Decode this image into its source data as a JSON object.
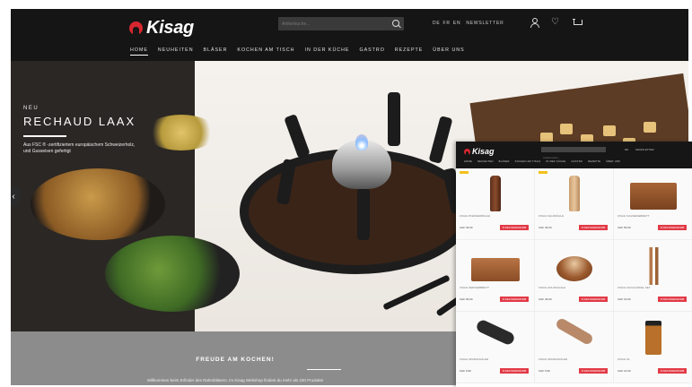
{
  "header": {
    "brand": "Kisag",
    "search_placeholder": "Artikelsuche...",
    "langs": [
      "DE",
      "FR",
      "EN"
    ],
    "newsletter": "NEWSLETTER",
    "icons": [
      "user-icon",
      "heart-icon",
      "cart-icon"
    ]
  },
  "nav": [
    {
      "label": "HOME",
      "active": true
    },
    {
      "label": "NEUHEITEN"
    },
    {
      "label": "BLÄSER"
    },
    {
      "label": "KOCHEN AM TISCH"
    },
    {
      "label": "IN DER KÜCHE"
    },
    {
      "label": "GASTRO"
    },
    {
      "label": "REZEPTE"
    },
    {
      "label": "ÜBER UNS"
    }
  ],
  "hero": {
    "kicker": "NEU",
    "title": "RECHAUD LAAX",
    "description": "Aus FSC ® -zertifiziertem europäischem Schweizerholz, und Gusseisen gefertigt",
    "prev_arrow": "‹"
  },
  "band": {
    "title": "FREUDE AM KOCHEN!",
    "description": "Willkommen beim Erfinder des Rahmbläsers. Im Kisag Webshop findest du mehr als 230 Produkte"
  },
  "shop": {
    "brand": "Kisag",
    "search_placeholder": "Artikelsuche...",
    "nav": [
      "HOME",
      "NEUHEITEN",
      "BLÄSER",
      "KOCHEN AM TISCH",
      "IN DER KÜCHE",
      "GASTRO",
      "REZEPTE",
      "ÜBER UNS"
    ],
    "products": [
      {
        "name": "KISAG PFEFFERMÜHLE",
        "price": "CHF 39.90",
        "button": "IN DEN WARENKORB",
        "badge": true
      },
      {
        "name": "KISAG SALZMÜHLE",
        "price": "CHF 49.90",
        "button": "IN DEN WARENKORB",
        "badge": true
      },
      {
        "name": "KISAG SCHNEIDEBRETT",
        "price": "CHF 59.90",
        "button": "IN DEN WARENKORB"
      },
      {
        "name": "KISAG SERVIERBRETT",
        "price": "CHF 69.90",
        "button": "IN DEN WARENKORB"
      },
      {
        "name": "KISAG HOLZSCHALE",
        "price": "CHF 49.90",
        "button": "IN DEN WARENKORB"
      },
      {
        "name": "KISAG KOCHLÖFFEL SET",
        "price": "CHF 19.90",
        "button": "IN DEN WARENKORB"
      },
      {
        "name": "KISAG SPARSCHÄLER",
        "price": "CHF 9.90",
        "button": "IN DEN WARENKORB"
      },
      {
        "name": "KISAG SPARSCHÄLER",
        "price": "CHF 9.90",
        "button": "IN DEN WARENKORB"
      },
      {
        "name": "KISAG ÖL",
        "price": "CHF 14.90",
        "button": "IN DEN WARENKORB"
      }
    ]
  },
  "colors": {
    "header_bg": "#151515",
    "accent": "#d8262f",
    "button": "#e23a46",
    "badge": "#f2c21b",
    "band": "#8c8c8c"
  }
}
